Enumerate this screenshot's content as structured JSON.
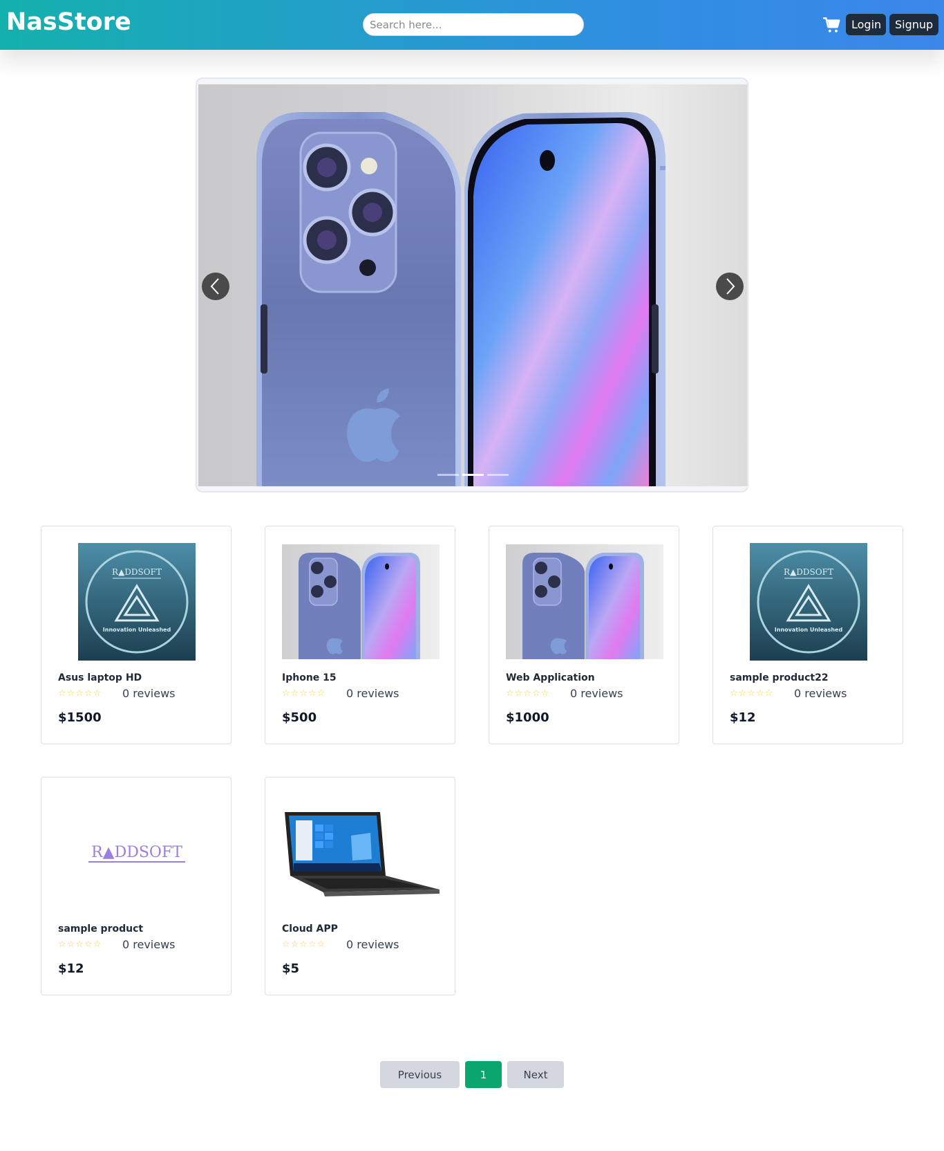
{
  "header": {
    "brand": "NasStore",
    "search_placeholder": "Search here...",
    "login_label": "Login",
    "signup_label": "Signup",
    "cart_icon": "cart-icon"
  },
  "carousel": {
    "prev_icon": "chevron-left-icon",
    "next_icon": "chevron-right-icon",
    "slide_count": 3,
    "active_slide": 2
  },
  "products": [
    {
      "name": "Asus laptop HD",
      "reviews": "0 reviews",
      "price": "$1500",
      "image": "raddsoft-badge-image"
    },
    {
      "name": "Iphone 15",
      "reviews": "0 reviews",
      "price": "$500",
      "image": "iphone-image"
    },
    {
      "name": "Web Application",
      "reviews": "0 reviews",
      "price": "$1000",
      "image": "iphone-image"
    },
    {
      "name": "sample product22",
      "reviews": "0 reviews",
      "price": "$12",
      "image": "raddsoft-badge-image"
    },
    {
      "name": "sample product",
      "reviews": "0 reviews",
      "price": "$12",
      "image": "raddsoft-logo-image"
    },
    {
      "name": "Cloud APP",
      "reviews": "0 reviews",
      "price": "$5",
      "image": "laptop-image"
    }
  ],
  "rating_stars": "☆☆☆☆☆",
  "pagination": {
    "previous_label": "Previous",
    "current_page": "1",
    "next_label": "Next"
  },
  "colors": {
    "header_gradient_start": "#14b1ad",
    "header_gradient_end": "#3b87ea",
    "button_dark": "#1e2b3c",
    "active_page": "#0aa66e",
    "star": "#f4d24b"
  }
}
